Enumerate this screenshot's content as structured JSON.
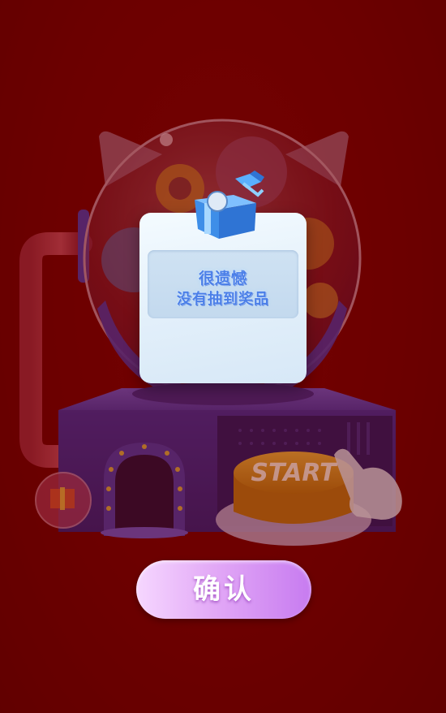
{
  "dialog": {
    "title": "很遗憾",
    "message": "没有抽到奖品"
  },
  "machine": {
    "button_label": "START"
  },
  "confirm": {
    "label": "确认"
  },
  "colors": {
    "background": "#8a0000",
    "card_text": "#4b7fe8",
    "button_gradient_start": "#f6d7ff",
    "button_gradient_end": "#c77bf0"
  }
}
